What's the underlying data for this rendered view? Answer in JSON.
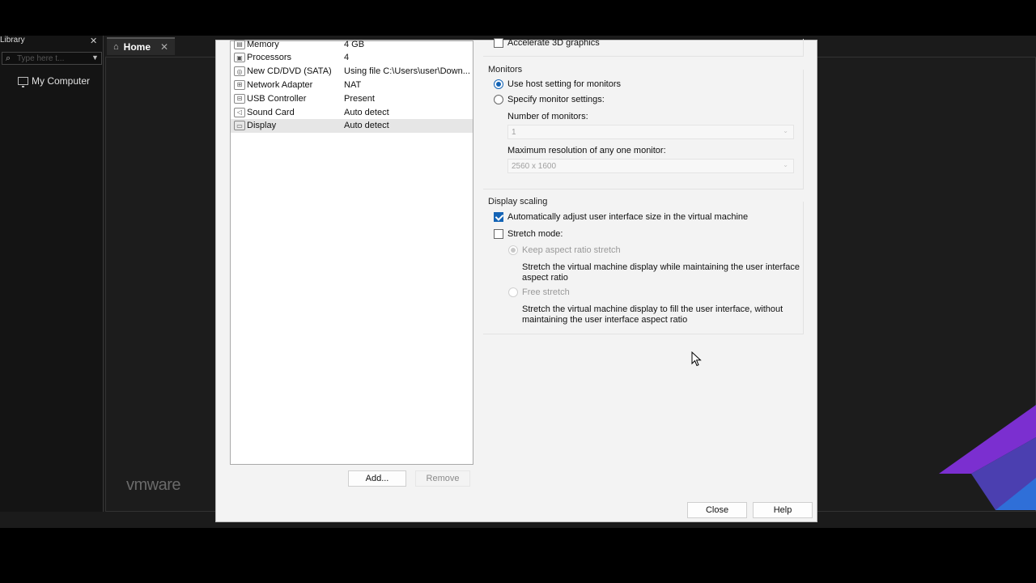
{
  "library": {
    "title": "Library",
    "close": "✕",
    "search_placeholder": "Type here t...",
    "tree_item": "My Computer"
  },
  "tabs": [
    {
      "label": "Home",
      "close": "✕"
    }
  ],
  "brand": {
    "logo_text": "vmware"
  },
  "devices": [
    {
      "name": "Memory",
      "value": "4 GB",
      "icon": "memory-icon"
    },
    {
      "name": "Processors",
      "value": "4",
      "icon": "cpu-icon"
    },
    {
      "name": "New CD/DVD (SATA)",
      "value": "Using file C:\\Users\\user\\Down...",
      "icon": "cd-icon"
    },
    {
      "name": "Network Adapter",
      "value": "NAT",
      "icon": "network-icon"
    },
    {
      "name": "USB Controller",
      "value": "Present",
      "icon": "usb-icon"
    },
    {
      "name": "Sound Card",
      "value": "Auto detect",
      "icon": "sound-icon"
    },
    {
      "name": "Display",
      "value": "Auto detect",
      "icon": "display-icon",
      "selected": true
    }
  ],
  "device_buttons": {
    "add": "Add...",
    "remove": "Remove"
  },
  "dialog_buttons": {
    "close": "Close",
    "help": "Help"
  },
  "display_panel": {
    "accelerate_3d": "Accelerate 3D graphics",
    "monitors_title": "Monitors",
    "use_host": "Use host setting for monitors",
    "specify": "Specify monitor settings:",
    "num_monitors_label": "Number of monitors:",
    "num_monitors_value": "1",
    "max_res_label": "Maximum resolution of any one monitor:",
    "max_res_value": "2560 x 1600",
    "scaling_title": "Display scaling",
    "auto_adjust": "Automatically adjust user interface size in the virtual machine",
    "stretch_mode": "Stretch mode:",
    "keep_aspect": "Keep aspect ratio stretch",
    "keep_aspect_desc": "Stretch the virtual machine display while maintaining the user interface aspect ratio",
    "free_stretch": "Free stretch",
    "free_stretch_desc": "Stretch the virtual machine display to fill the user interface, without maintaining the user interface aspect ratio"
  },
  "colors": {
    "accent": "#1363b5",
    "purple": "#8a2be2"
  }
}
